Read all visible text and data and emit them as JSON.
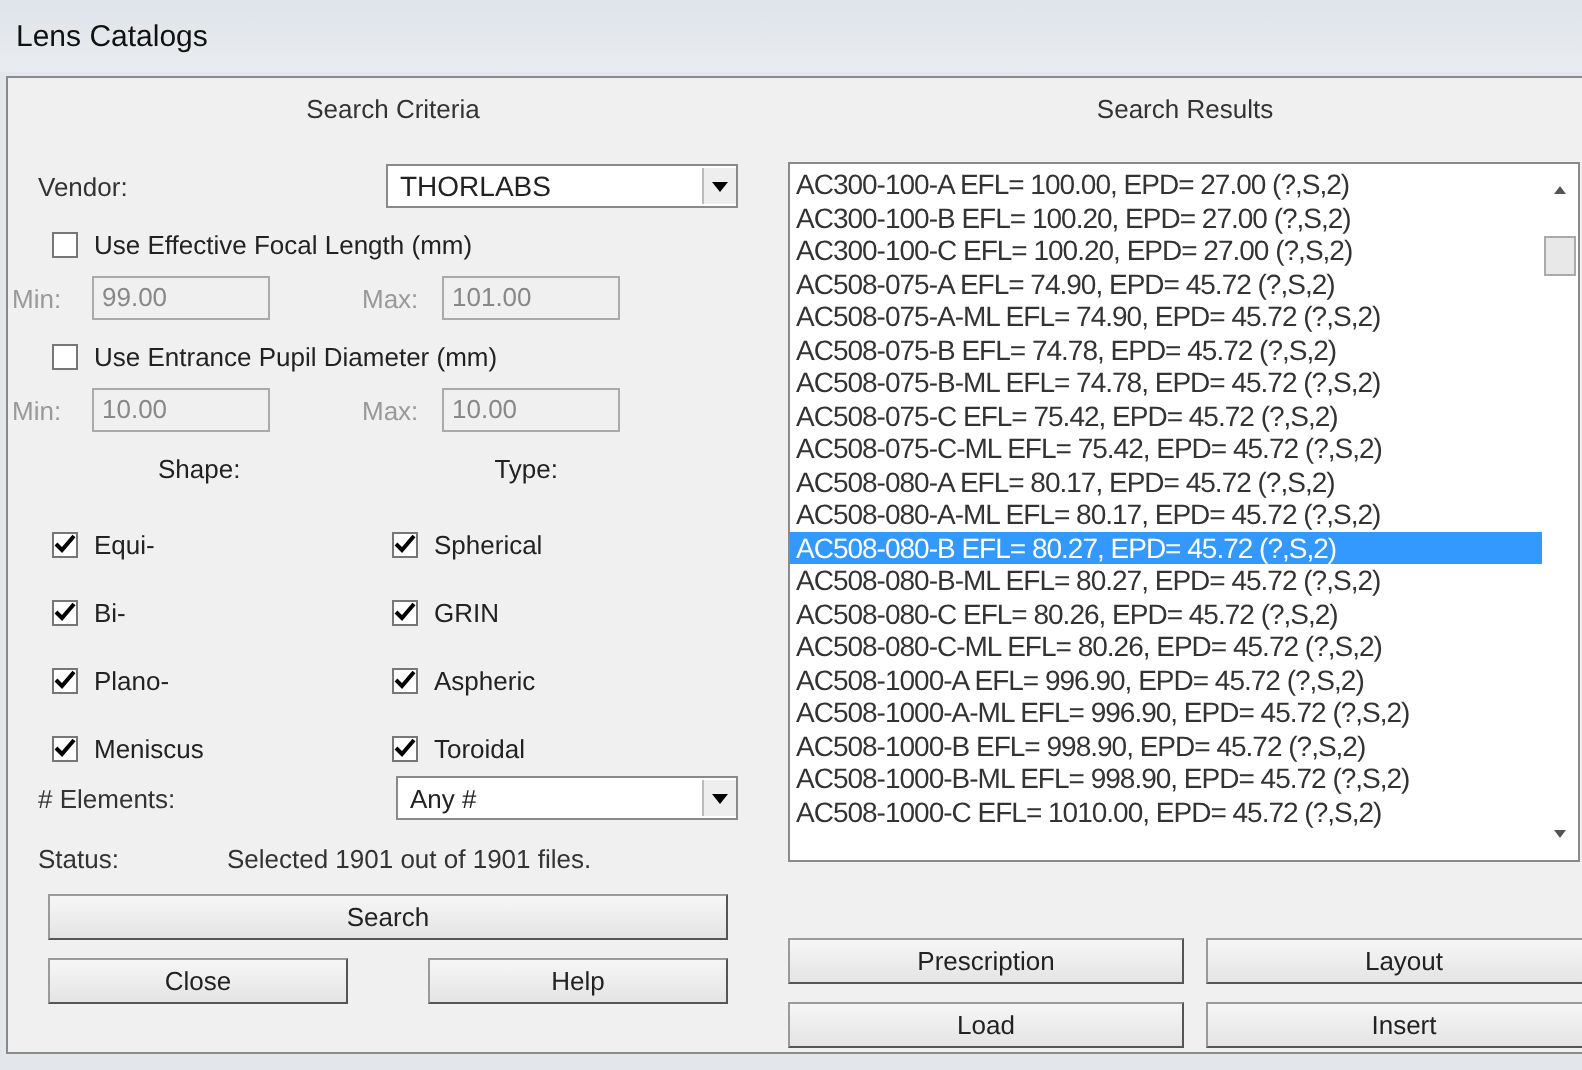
{
  "window": {
    "title": "Lens Catalogs"
  },
  "criteria": {
    "heading": "Search Criteria",
    "vendor": {
      "label": "Vendor:",
      "value": "THORLABS"
    },
    "ranges": [
      {
        "label": "Use Effective Focal Length (mm)",
        "checked": false,
        "min_label": "Min:",
        "min": "99.00",
        "max_label": "Max:",
        "max": "101.00",
        "disabled": true
      },
      {
        "label": "Use Entrance Pupil Diameter (mm)",
        "checked": false,
        "min_label": "Min:",
        "min": "10.00",
        "max_label": "Max:",
        "max": "10.00",
        "disabled": true
      }
    ],
    "shape_heading": "Shape:",
    "type_heading": "Type:",
    "shapes": [
      {
        "label": "Equi-",
        "checked": true
      },
      {
        "label": "Bi-",
        "checked": true
      },
      {
        "label": "Plano-",
        "checked": true
      },
      {
        "label": "Meniscus",
        "checked": true
      }
    ],
    "types": [
      {
        "label": "Spherical",
        "checked": true
      },
      {
        "label": "GRIN",
        "checked": true
      },
      {
        "label": "Aspheric",
        "checked": true
      },
      {
        "label": "Toroidal",
        "checked": true
      }
    ],
    "elements": {
      "label": "# Elements:",
      "value": "Any #"
    },
    "status": {
      "label": "Status:",
      "text": "Selected 1901 out of 1901 files."
    },
    "search_button": "Search",
    "buttons": [
      "Close",
      "Help"
    ]
  },
  "results": {
    "heading": "Search Results",
    "items": [
      {
        "text": "AC300-100-A EFL= 100.00, EPD= 27.00 (?,S,2)",
        "selected": false
      },
      {
        "text": "AC300-100-B EFL= 100.20, EPD= 27.00 (?,S,2)",
        "selected": false
      },
      {
        "text": "AC300-100-C EFL= 100.20, EPD= 27.00 (?,S,2)",
        "selected": false
      },
      {
        "text": "AC508-075-A EFL= 74.90, EPD= 45.72 (?,S,2)",
        "selected": false
      },
      {
        "text": "AC508-075-A-ML EFL= 74.90, EPD= 45.72 (?,S,2)",
        "selected": false
      },
      {
        "text": "AC508-075-B EFL= 74.78, EPD= 45.72 (?,S,2)",
        "selected": false
      },
      {
        "text": "AC508-075-B-ML EFL= 74.78, EPD= 45.72 (?,S,2)",
        "selected": false
      },
      {
        "text": "AC508-075-C EFL= 75.42, EPD= 45.72 (?,S,2)",
        "selected": false
      },
      {
        "text": "AC508-075-C-ML EFL= 75.42, EPD= 45.72 (?,S,2)",
        "selected": false
      },
      {
        "text": "AC508-080-A EFL= 80.17, EPD= 45.72 (?,S,2)",
        "selected": false
      },
      {
        "text": "AC508-080-A-ML EFL= 80.17, EPD= 45.72 (?,S,2)",
        "selected": false
      },
      {
        "text": "AC508-080-B EFL= 80.27, EPD= 45.72 (?,S,2)",
        "selected": true
      },
      {
        "text": "AC508-080-B-ML EFL= 80.27, EPD= 45.72 (?,S,2)",
        "selected": false
      },
      {
        "text": "AC508-080-C EFL= 80.26, EPD= 45.72 (?,S,2)",
        "selected": false
      },
      {
        "text": "AC508-080-C-ML EFL= 80.26, EPD= 45.72 (?,S,2)",
        "selected": false
      },
      {
        "text": "AC508-1000-A EFL= 996.90, EPD= 45.72 (?,S,2)",
        "selected": false
      },
      {
        "text": "AC508-1000-A-ML EFL= 996.90, EPD= 45.72 (?,S,2)",
        "selected": false
      },
      {
        "text": "AC508-1000-B EFL= 998.90, EPD= 45.72 (?,S,2)",
        "selected": false
      },
      {
        "text": "AC508-1000-B-ML EFL= 998.90, EPD= 45.72 (?,S,2)",
        "selected": false
      },
      {
        "text": "AC508-1000-C EFL= 1010.00, EPD= 45.72 (?,S,2)",
        "selected": false
      }
    ],
    "buttons": [
      "Prescription",
      "Layout",
      "Load",
      "Insert"
    ]
  }
}
